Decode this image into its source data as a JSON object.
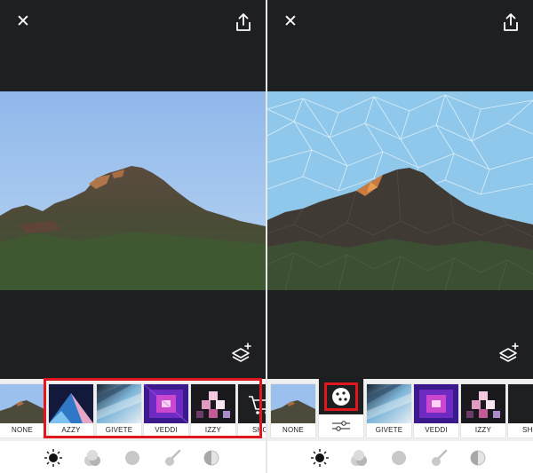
{
  "left_screen": {
    "filters": [
      {
        "label": "NONE"
      },
      {
        "label": "AZZY"
      },
      {
        "label": "GIVETE"
      },
      {
        "label": "VEDDI"
      },
      {
        "label": "IZZY"
      },
      {
        "label": "SHO"
      }
    ],
    "highlight_label": "filter strip highlighted"
  },
  "right_screen": {
    "filters": [
      {
        "label": "NONE"
      },
      {
        "label": ""
      },
      {
        "label": "GIVETE"
      },
      {
        "label": "VEDDI"
      },
      {
        "label": "IZZY"
      },
      {
        "label": "SHO"
      }
    ]
  },
  "icons": {
    "close": "close-icon",
    "share": "share-icon",
    "layers": "layers-add-icon",
    "randomize": "dice-icon",
    "adjust": "sliders-icon",
    "modes": [
      "sun-icon",
      "blend-icon",
      "circle-icon",
      "brush-icon",
      "contrast-icon"
    ]
  },
  "colors": {
    "chrome": "#1e1f21",
    "highlight": "#e0171c",
    "strip": "#f0f0f0"
  }
}
